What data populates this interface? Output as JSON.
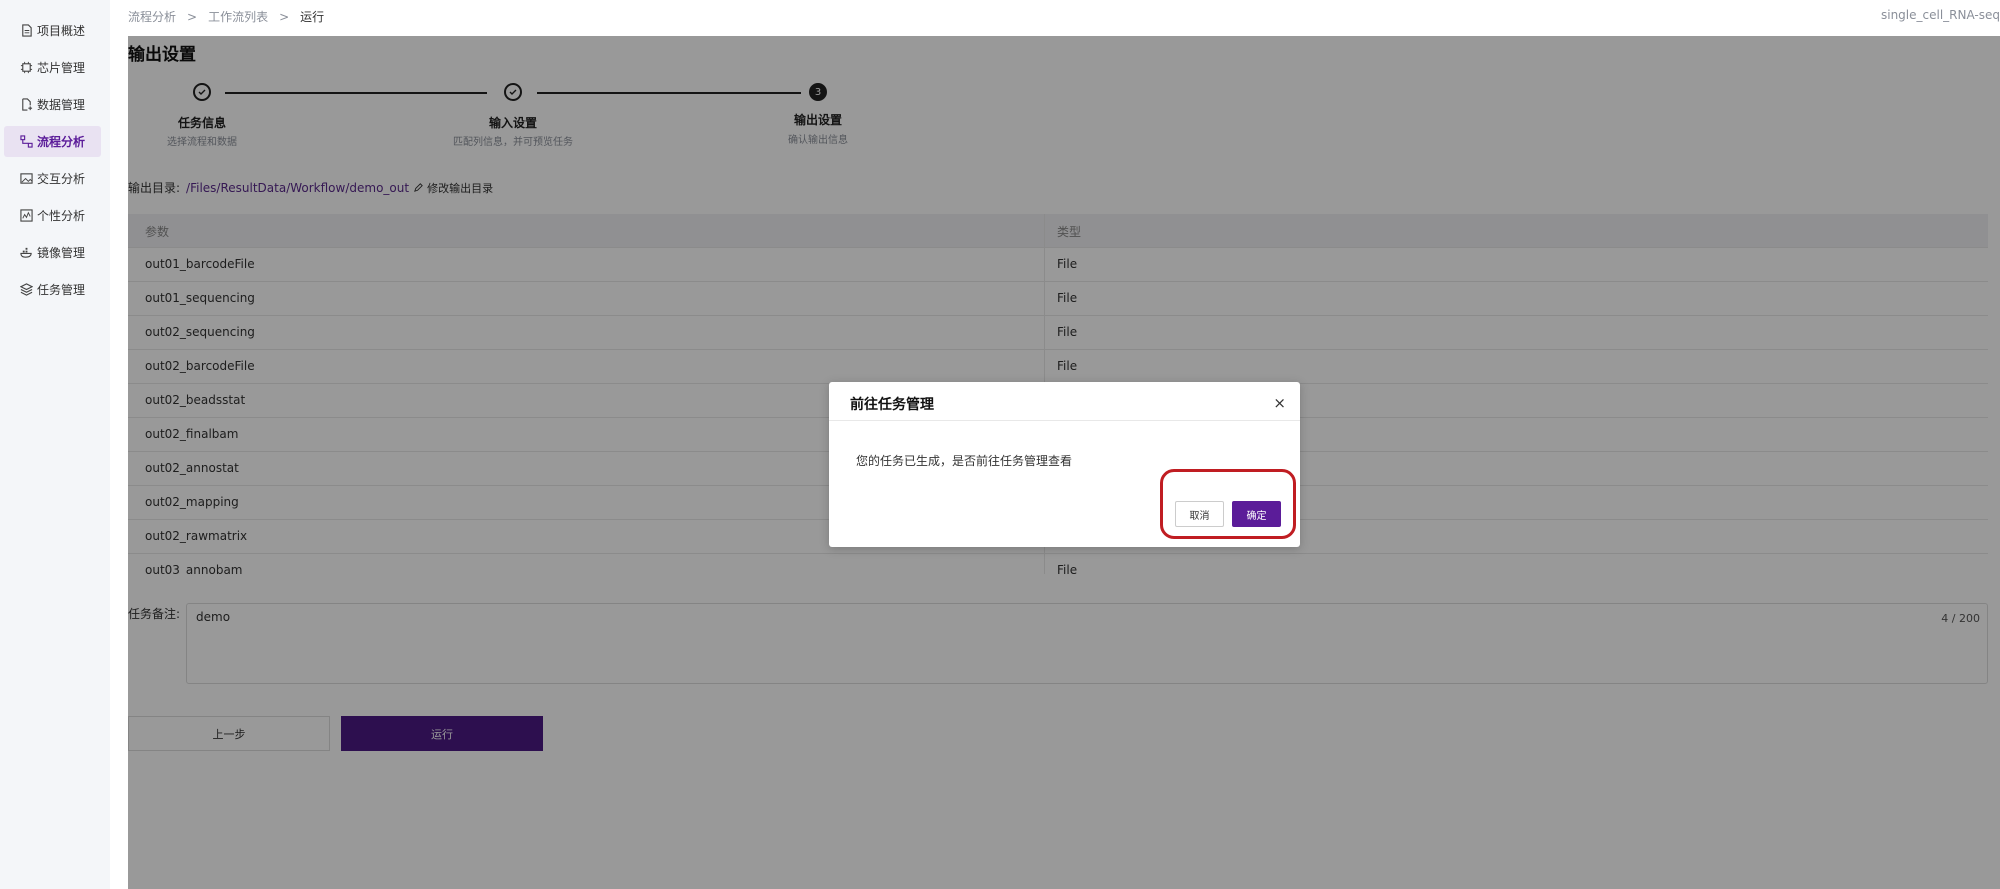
{
  "sidebar": {
    "items": [
      {
        "label": "项目概述",
        "icon": "document-icon"
      },
      {
        "label": "芯片管理",
        "icon": "chip-icon"
      },
      {
        "label": "数据管理",
        "icon": "file-add-icon"
      },
      {
        "label": "流程分析",
        "icon": "flow-icon",
        "active": true
      },
      {
        "label": "交互分析",
        "icon": "image-icon"
      },
      {
        "label": "个性分析",
        "icon": "chart-icon"
      },
      {
        "label": "镜像管理",
        "icon": "docker-icon"
      },
      {
        "label": "任务管理",
        "icon": "layers-icon"
      }
    ]
  },
  "header": {
    "breadcrumb": [
      "流程分析",
      "工作流列表",
      "运行"
    ],
    "separator": ">",
    "project": "single_cell_RNA-seq"
  },
  "main": {
    "title": "输出设置",
    "steps": [
      {
        "title": "任务信息",
        "desc": "选择流程和数据",
        "status": "done"
      },
      {
        "title": "输入设置",
        "desc": "匹配列信息，并可预览任务",
        "status": "done"
      },
      {
        "title": "输出设置",
        "desc": "确认输出信息",
        "status": "current",
        "number": "3"
      }
    ],
    "output_dir_label": "输出目录:",
    "output_dir_path": "/Files/ResultData/Workflow/demo_out",
    "edit_output_dir": "修改输出目录",
    "table": {
      "headers": [
        "参数",
        "类型"
      ],
      "rows": [
        [
          "out01_barcodeFile",
          "File"
        ],
        [
          "out01_sequencing",
          "File"
        ],
        [
          "out02_sequencing",
          "File"
        ],
        [
          "out02_barcodeFile",
          "File"
        ],
        [
          "out02_beadsstat",
          ""
        ],
        [
          "out02_finalbam",
          ""
        ],
        [
          "out02_annostat",
          ""
        ],
        [
          "out02_mapping",
          ""
        ],
        [
          "out02_rawmatrix",
          ""
        ],
        [
          "out03_annobam",
          "File"
        ]
      ]
    },
    "remark_label": "任务备注:",
    "remark_value": "demo",
    "remark_count": "4 / 200",
    "prev_button": "上一步",
    "run_button": "运行"
  },
  "modal": {
    "title": "前往任务管理",
    "close": "×",
    "message": "您的任务已生成，是否前往任务管理查看",
    "cancel": "取消",
    "ok": "确定"
  },
  "colors": {
    "accent": "#5b1c99",
    "highlight": "#c01d22",
    "sidebar_bg": "#f4f6f9"
  }
}
